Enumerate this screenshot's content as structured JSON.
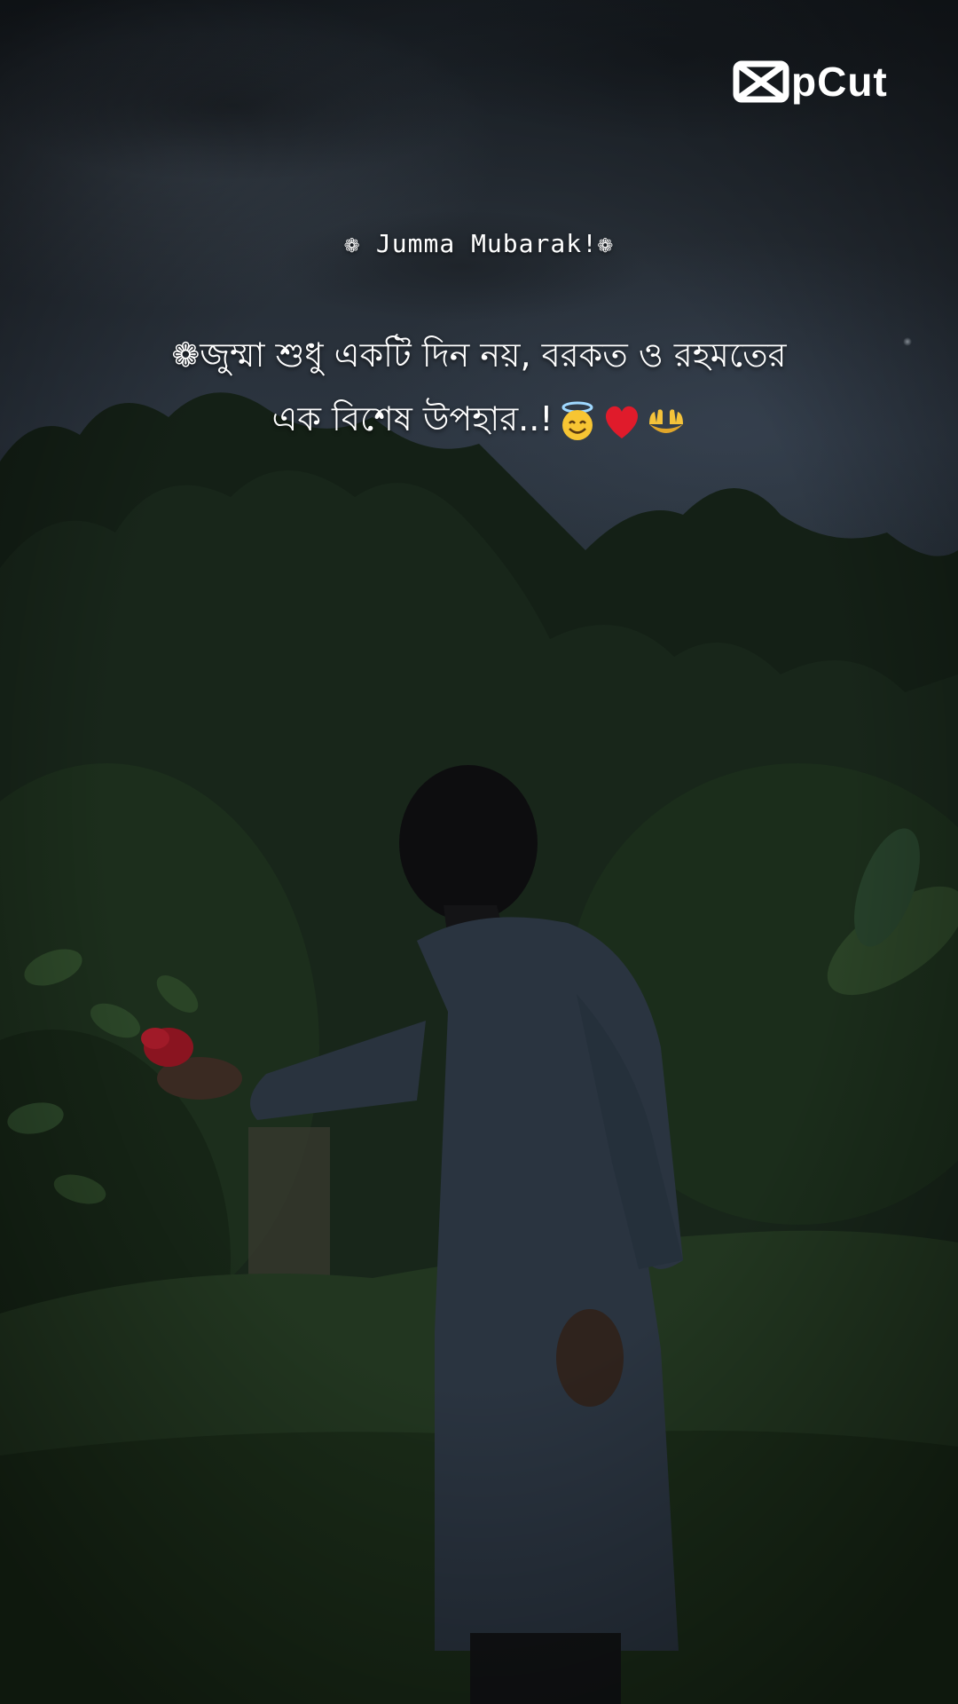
{
  "watermark": {
    "brand": "CapCut",
    "logo_text": "pCut",
    "logo_icon": "capcut-logo-icon"
  },
  "overlay": {
    "heading": "❁ Jumma Mubarak!❁",
    "quote_line_1": "❁জুম্মা শুধু একটি দিন নয়, বরকত ও রহমতের",
    "quote_line_2": "এক বিশেষ উপহার..!",
    "emojis": [
      "smiling-face-with-halo-icon",
      "red-heart-icon",
      "palms-up-together-icon"
    ]
  },
  "scene": {
    "description_colors": {
      "sky": "#2c3540",
      "foliage_dark": "#0f1a12",
      "foliage_mid": "#1f3320",
      "grass": "#243a20",
      "kurta": "#2a3440",
      "flower": "#8a1420"
    }
  }
}
